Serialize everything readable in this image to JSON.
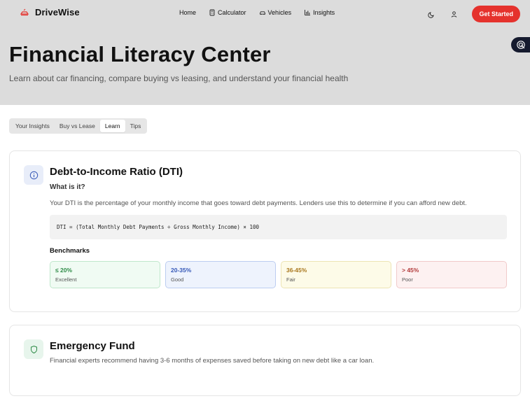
{
  "nav": {
    "brand": "DriveWise",
    "links": [
      {
        "label": "Home",
        "icon": ""
      },
      {
        "label": "Calculator",
        "icon": "calculator-icon"
      },
      {
        "label": "Vehicles",
        "icon": "car-icon"
      },
      {
        "label": "Insights",
        "icon": "bar-chart-icon"
      }
    ],
    "cta": "Get Started"
  },
  "hero": {
    "title": "Financial Literacy Center",
    "subtitle": "Learn about car financing, compare buying vs leasing, and understand your financial health"
  },
  "tabs": [
    {
      "label": "Your Insights",
      "active": false
    },
    {
      "label": "Buy vs Lease",
      "active": false
    },
    {
      "label": "Learn",
      "active": true
    },
    {
      "label": "Tips",
      "active": false
    }
  ],
  "dti": {
    "title": "Debt-to-Income Ratio (DTI)",
    "what_label": "What is it?",
    "description": "Your DTI is the percentage of your monthly income that goes toward debt payments. Lenders use this to determine if you can afford new debt.",
    "formula": "DTI = (Total Monthly Debt Payments ÷ Gross Monthly Income) × 100",
    "benchmarks_label": "Benchmarks",
    "benchmarks": [
      {
        "range": "≤ 20%",
        "label": "Excellent",
        "color": "#2e8b47",
        "bg": "#f0fbf3",
        "border": "#bfe7cb"
      },
      {
        "range": "20-35%",
        "label": "Good",
        "color": "#3558b7",
        "bg": "#eef3fd",
        "border": "#bccdf1"
      },
      {
        "range": "36-45%",
        "label": "Fair",
        "color": "#a8761c",
        "bg": "#fdfbe8",
        "border": "#ece4b4"
      },
      {
        "range": "> 45%",
        "label": "Poor",
        "color": "#b23a3a",
        "bg": "#fdf1f1",
        "border": "#f1caca"
      }
    ]
  },
  "emergency": {
    "title": "Emergency Fund",
    "description": "Financial experts recommend having 3-6 months of expenses saved before taking on new debt like a car loan."
  },
  "colors": {
    "accent": "#e5322d",
    "header_bg": "#dcdcdc"
  }
}
